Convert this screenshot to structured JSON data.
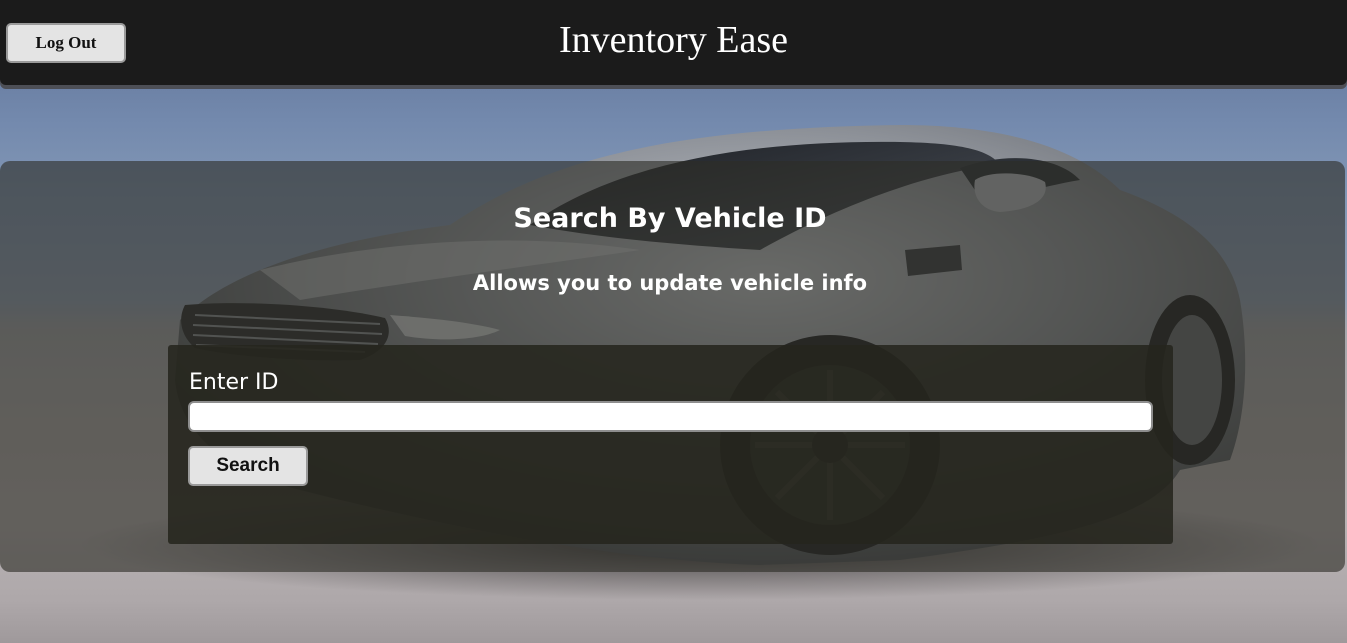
{
  "header": {
    "title": "Inventory Ease",
    "logout_label": "Log Out"
  },
  "panel": {
    "title": "Search By Vehicle ID",
    "subtitle": "Allows you to update vehicle info"
  },
  "form": {
    "id_label": "Enter ID",
    "id_value": "",
    "id_placeholder": "",
    "search_label": "Search"
  },
  "background": {
    "image": "car-photo",
    "sky_color": "#7389ad",
    "floor_color": "#b3aeae"
  },
  "colors": {
    "header_bg": "#1b1b1b",
    "button_bg": "#e4e4e4"
  }
}
